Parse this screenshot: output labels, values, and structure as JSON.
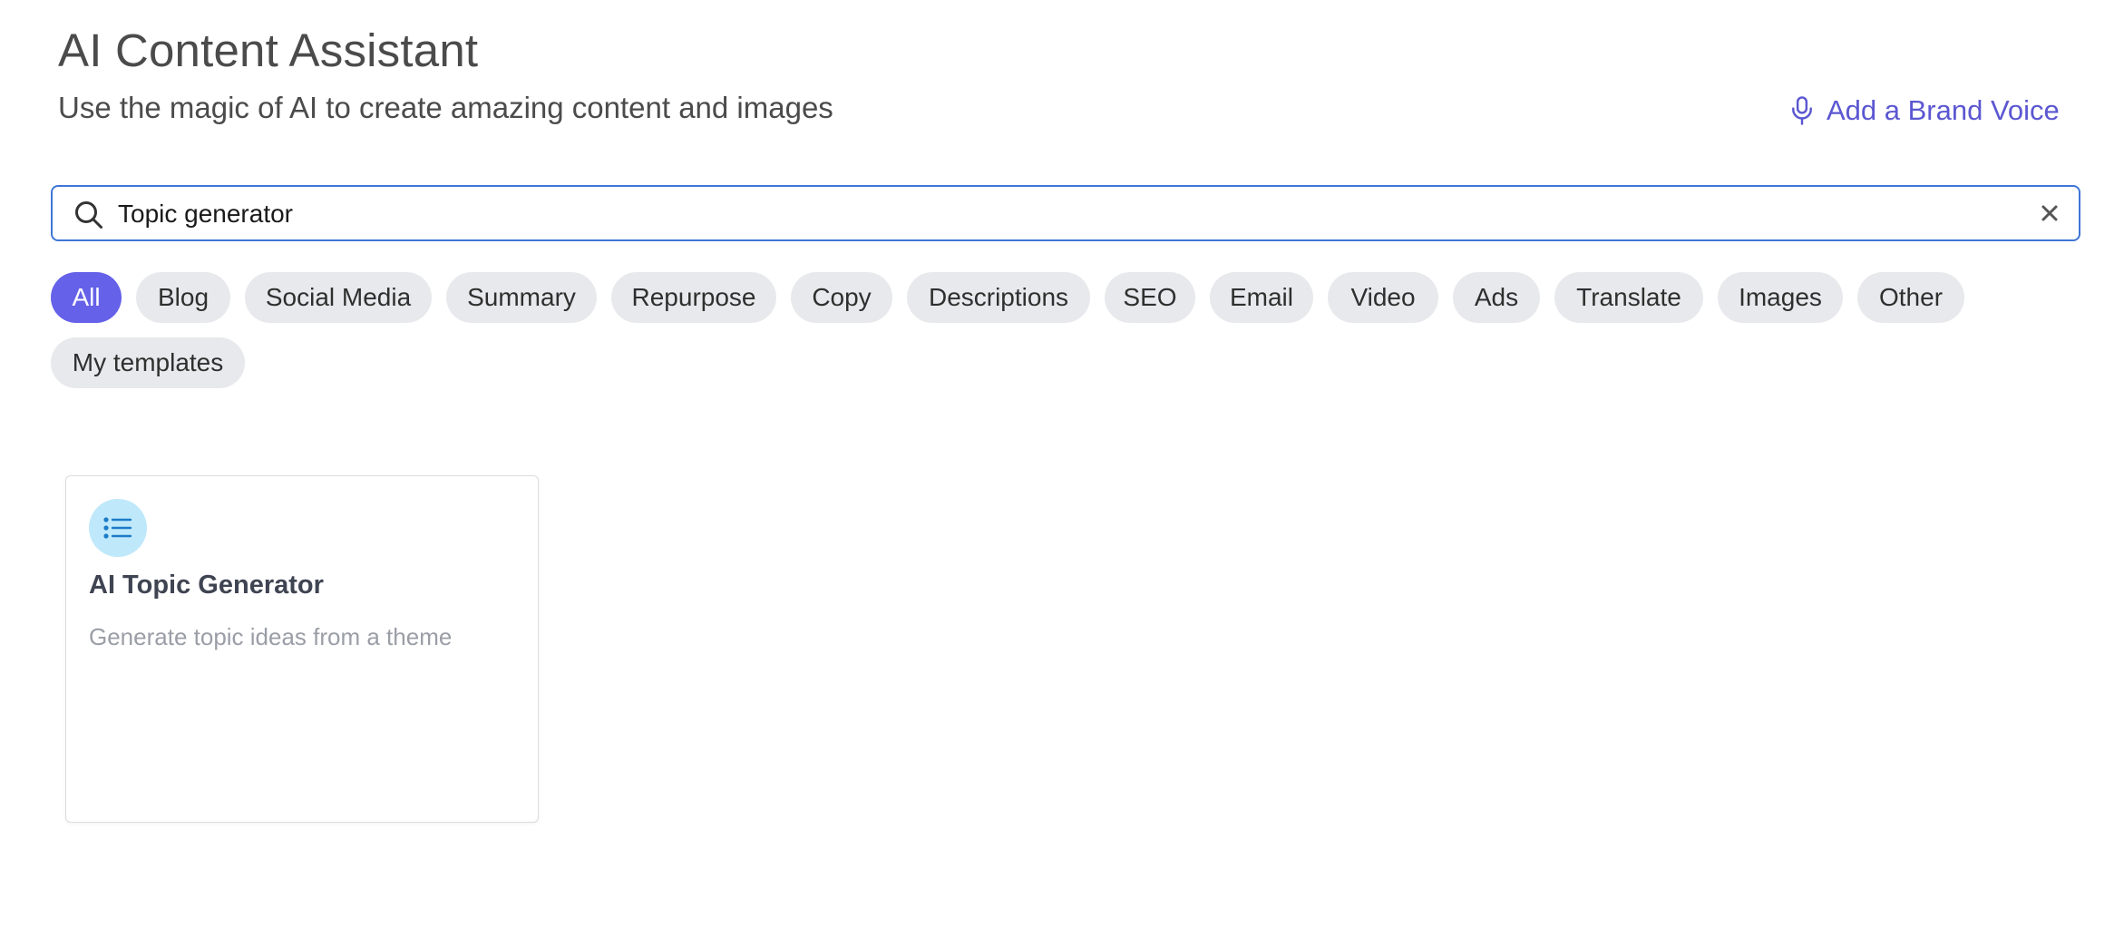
{
  "header": {
    "title": "AI Content Assistant",
    "subtitle": "Use the magic of AI to create amazing content and images",
    "brand_voice_label": "Add a Brand Voice"
  },
  "search": {
    "value": "Topic generator"
  },
  "filters": {
    "active": "All",
    "items": [
      "All",
      "Blog",
      "Social Media",
      "Summary",
      "Repurpose",
      "Copy",
      "Descriptions",
      "SEO",
      "Email",
      "Video",
      "Ads",
      "Translate",
      "Images",
      "Other",
      "My templates"
    ]
  },
  "results": [
    {
      "icon": "list-icon",
      "title": "AI Topic Generator",
      "description": "Generate topic ideas from a theme"
    }
  ],
  "colors": {
    "accent": "#6561e8",
    "link": "#5b57d1",
    "search_border": "#3f76d6",
    "chip_bg": "#e8e9ec",
    "icon_bg": "#bfe9fb",
    "icon_fg": "#1d7bc6"
  }
}
